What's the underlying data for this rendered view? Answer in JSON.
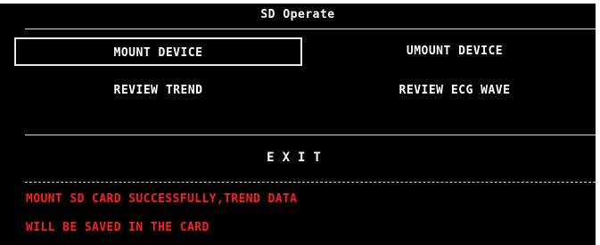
{
  "dialog": {
    "title": "SD Operate"
  },
  "buttons": {
    "mount": "MOUNT DEVICE",
    "umount": "UMOUNT DEVICE",
    "review_trend": "REVIEW TREND",
    "review_ecg": "REVIEW ECG WAVE",
    "exit": "EXIT"
  },
  "status": {
    "line1": "MOUNT SD CARD SUCCESSFULLY,TREND DATA",
    "line2": "WILL BE SAVED IN THE CARD"
  },
  "colors": {
    "background": "#000000",
    "text": "#ffffff",
    "status_text": "#ff1e1e"
  }
}
